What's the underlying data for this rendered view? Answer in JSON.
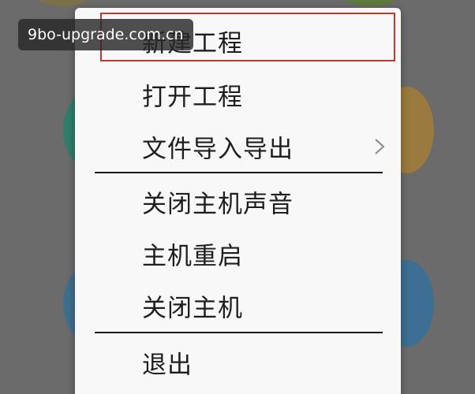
{
  "menu": {
    "items": [
      {
        "label": "新建工程"
      },
      {
        "label": "打开工程"
      },
      {
        "label": "文件导入导出",
        "has_submenu": true,
        "submenu_icon": "chevron-right-icon"
      },
      {
        "label": "关闭主机声音"
      },
      {
        "label": "主机重启"
      },
      {
        "label": "关闭主机"
      },
      {
        "label": "退出"
      }
    ],
    "highlighted_item": "新建工程"
  },
  "watermark": {
    "text": "9bo-upgrade.com.cn"
  },
  "colors": {
    "overlay": "#6b6b6b",
    "menu_background": "#f8f8f8",
    "highlight_border": "#c0392b",
    "text": "#1e1e1e"
  }
}
